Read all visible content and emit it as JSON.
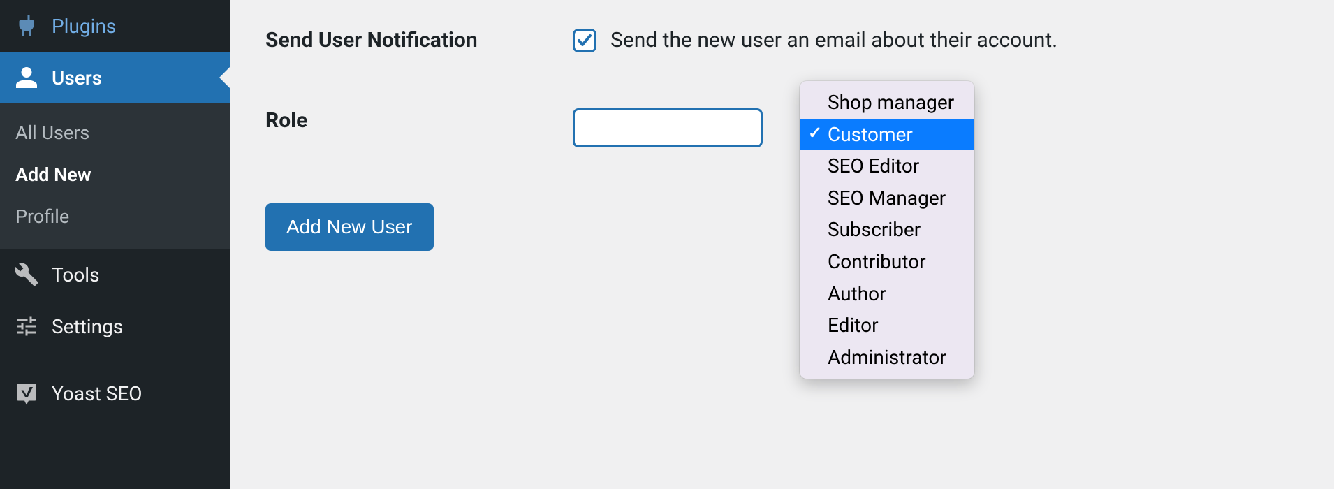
{
  "sidebar": {
    "items": [
      {
        "label": "Plugins",
        "icon": "plug-icon"
      },
      {
        "label": "Users",
        "icon": "user-icon",
        "active": true
      },
      {
        "label": "Tools",
        "icon": "wrench-icon"
      },
      {
        "label": "Settings",
        "icon": "sliders-icon"
      },
      {
        "label": "Yoast SEO",
        "icon": "yoast-icon"
      }
    ],
    "submenu": {
      "items": [
        {
          "label": "All Users"
        },
        {
          "label": "Add New",
          "current": true
        },
        {
          "label": "Profile"
        }
      ]
    }
  },
  "form": {
    "notification": {
      "label": "Send User Notification",
      "checkbox_label": "Send the new user an email about their account.",
      "checked": true
    },
    "role": {
      "label": "Role",
      "selected": "Customer",
      "options": [
        "Shop manager",
        "Customer",
        "SEO Editor",
        "SEO Manager",
        "Subscriber",
        "Contributor",
        "Author",
        "Editor",
        "Administrator"
      ]
    },
    "submit_label": "Add New User"
  }
}
